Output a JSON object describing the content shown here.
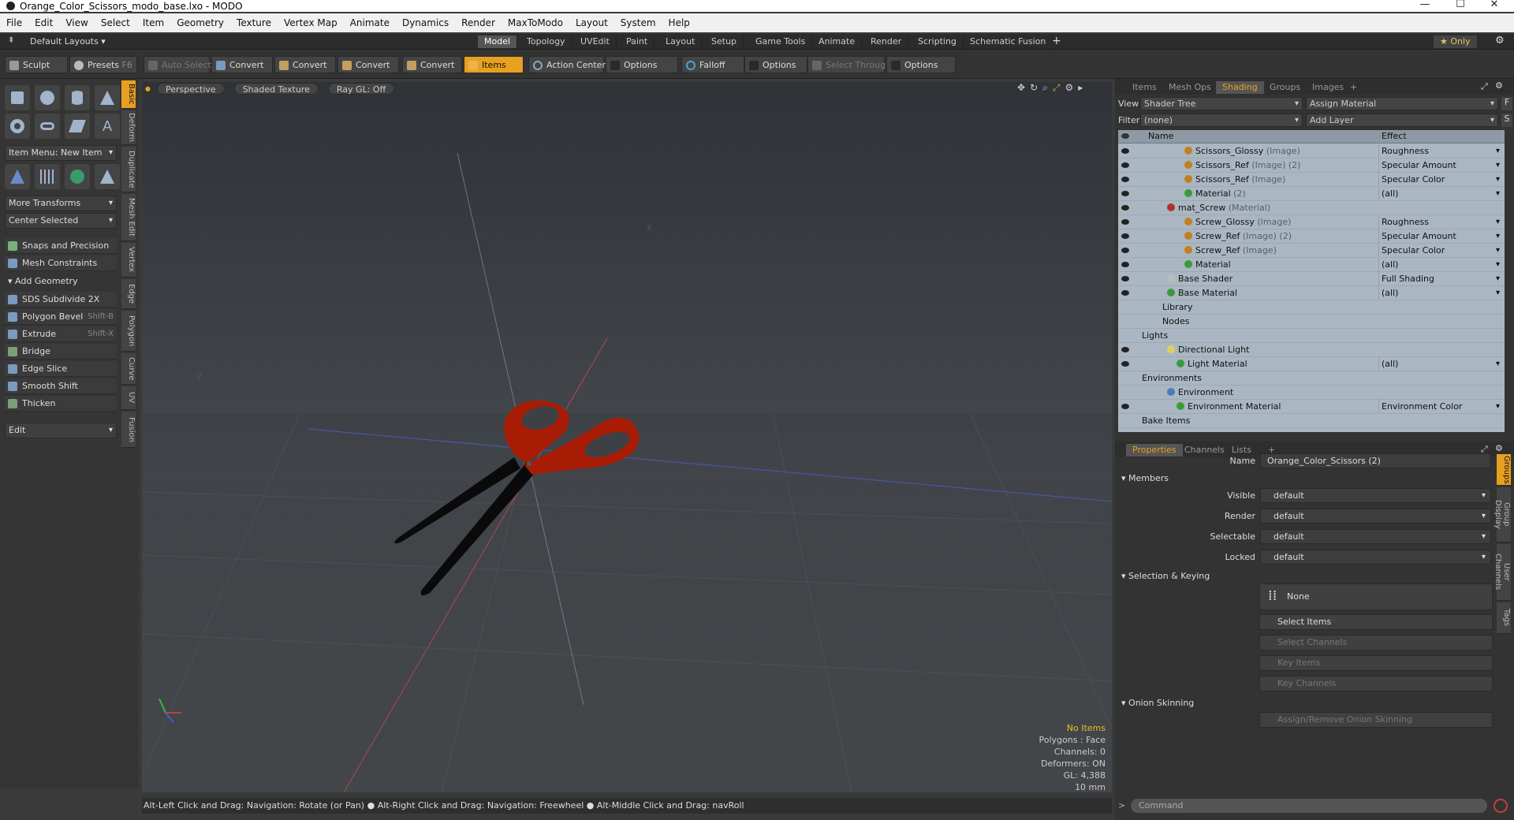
{
  "window": {
    "title": "Orange_Color_Scissors_modo_base.lxo - MODO",
    "min": "—",
    "max": "☐",
    "close": "✕"
  },
  "menu": [
    "File",
    "Edit",
    "View",
    "Select",
    "Item",
    "Geometry",
    "Texture",
    "Vertex Map",
    "Animate",
    "Dynamics",
    "Render",
    "MaxToModo",
    "Layout",
    "System",
    "Help"
  ],
  "layouts": {
    "preset": "Default Layouts ▾",
    "tabs": [
      "Model",
      "Topology",
      "UVEdit",
      "Paint",
      "Layout",
      "Setup",
      "Game Tools",
      "Animate",
      "Render",
      "Scripting",
      "Schematic Fusion"
    ],
    "add": "+",
    "only": "★  Only"
  },
  "toolbar": {
    "sculpt": "Sculpt",
    "presets": "Presets",
    "presets_key": "F6",
    "auto_select": "Auto Select",
    "convert": "Convert",
    "items": "Items",
    "action_center": "Action Center",
    "options": "Options",
    "falloff": "Falloff",
    "select_through": "Select Through"
  },
  "left": {
    "tabs": [
      "Basic",
      "Deform",
      "Duplicate",
      "Mesh Edit",
      "Vertex",
      "Edge",
      "Polygon",
      "Curve",
      "UV",
      "Fusion"
    ],
    "item_menu": "Item Menu: New Item",
    "more_transforms": "More Transforms",
    "center_selected": "Center Selected",
    "snaps": "Snaps and Precision",
    "constraints": "Mesh Constraints",
    "add_geometry": "Add Geometry",
    "tools": [
      {
        "label": "SDS Subdivide 2X",
        "key": ""
      },
      {
        "label": "Polygon Bevel",
        "key": "Shift-B"
      },
      {
        "label": "Extrude",
        "key": "Shift-X"
      },
      {
        "label": "Bridge",
        "key": ""
      },
      {
        "label": "Edge Slice",
        "key": ""
      },
      {
        "label": "Smooth Shift",
        "key": ""
      },
      {
        "label": "Thicken",
        "key": ""
      }
    ],
    "edit": "Edit"
  },
  "viewport": {
    "chips": [
      "Perspective",
      "Shaded Texture",
      "Ray GL: Off"
    ],
    "info": {
      "items": "No Items",
      "polygons": "Polygons : Face",
      "channels": "Channels: 0",
      "deformers": "Deformers: ON",
      "gl": "GL: 4,388",
      "scale": "10 mm"
    },
    "axis_z": "Z",
    "axis_x": "X"
  },
  "status": "Alt-Left Click and Drag: Navigation: Rotate (or Pan) ● Alt-Right Click and Drag: Navigation: Freewheel ● Alt-Middle Click and Drag: navRoll",
  "shading": {
    "tabs": [
      "Items",
      "Mesh Ops",
      "Shading",
      "Groups",
      "Images"
    ],
    "add": "+",
    "view_label": "View",
    "view": "Shader Tree",
    "assign": "Assign Material",
    "filter_label": "Filter",
    "filter": "(none)",
    "add_layer": "Add Layer",
    "col_name": "Name",
    "col_effect": "Effect",
    "rows": [
      {
        "name": "Scissors_Glossy",
        "type": " (Image)",
        "effect": "Roughness",
        "ind": 84,
        "ball": "#c08020",
        "eye": true,
        "dd": true
      },
      {
        "name": "Scissors_Ref",
        "type": " (Image) (2)",
        "effect": "Specular Amount",
        "ind": 84,
        "ball": "#c08020",
        "eye": true,
        "dd": true
      },
      {
        "name": "Scissors_Ref",
        "type": " (Image)",
        "effect": "Specular Color",
        "ind": 84,
        "ball": "#c08020",
        "eye": true,
        "dd": true
      },
      {
        "name": "Material",
        "type": " (2)",
        "effect": "(all)",
        "ind": 84,
        "ball": "#3a9a3a",
        "eye": true,
        "dd": true
      },
      {
        "name": "mat_Screw",
        "type": " (Material)",
        "effect": "",
        "ind": 62,
        "ball": "#b03030",
        "eye": true,
        "dd": false
      },
      {
        "name": "Screw_Glossy",
        "type": " (Image)",
        "effect": "Roughness",
        "ind": 84,
        "ball": "#c08020",
        "eye": true,
        "dd": true
      },
      {
        "name": "Screw_Ref",
        "type": " (Image) (2)",
        "effect": "Specular Amount",
        "ind": 84,
        "ball": "#c08020",
        "eye": true,
        "dd": true
      },
      {
        "name": "Screw_Ref",
        "type": " (Image)",
        "effect": "Specular Color",
        "ind": 84,
        "ball": "#c08020",
        "eye": true,
        "dd": true
      },
      {
        "name": "Material",
        "type": "",
        "effect": "(all)",
        "ind": 84,
        "ball": "#3a9a3a",
        "eye": true,
        "dd": true
      },
      {
        "name": "Base Shader",
        "type": "",
        "effect": "Full Shading",
        "ind": 62,
        "ball": "#bbbbbb",
        "eye": true,
        "dd": true
      },
      {
        "name": "Base Material",
        "type": "",
        "effect": "(all)",
        "ind": 62,
        "ball": "#3a9a3a",
        "eye": true,
        "dd": true
      },
      {
        "name": "Library",
        "type": "",
        "effect": "",
        "ind": 56,
        "ball": "",
        "eye": false,
        "dd": false
      },
      {
        "name": "Nodes",
        "type": "",
        "effect": "",
        "ind": 56,
        "ball": "",
        "eye": false,
        "dd": false
      },
      {
        "name": "Lights",
        "type": "",
        "effect": "",
        "ind": 30,
        "ball": "",
        "eye": false,
        "dd": false
      },
      {
        "name": "Directional Light",
        "type": "",
        "effect": "",
        "ind": 62,
        "ball": "#ddd060",
        "eye": true,
        "dd": false
      },
      {
        "name": "Light Material",
        "type": "",
        "effect": "(all)",
        "ind": 74,
        "ball": "#3a9a3a",
        "eye": true,
        "dd": true
      },
      {
        "name": "Environments",
        "type": "",
        "effect": "",
        "ind": 30,
        "ball": "",
        "eye": false,
        "dd": false
      },
      {
        "name": "Environment",
        "type": "",
        "effect": "",
        "ind": 62,
        "ball": "#4a7ac0",
        "eye": false,
        "dd": false
      },
      {
        "name": "Environment Material",
        "type": "",
        "effect": "Environment Color",
        "ind": 74,
        "ball": "#3a9a3a",
        "eye": true,
        "dd": true
      },
      {
        "name": "Bake Items",
        "type": "",
        "effect": "",
        "ind": 30,
        "ball": "",
        "eye": false,
        "dd": false
      }
    ]
  },
  "props": {
    "tabs": [
      "Properties",
      "Channels",
      "Lists"
    ],
    "add": "+",
    "name_label": "Name",
    "name_value": "Orange_Color_Scissors (2)",
    "members": "Members",
    "fields": [
      {
        "label": "Visible",
        "value": "default"
      },
      {
        "label": "Render",
        "value": "default"
      },
      {
        "label": "Selectable",
        "value": "default"
      },
      {
        "label": "Locked",
        "value": "default"
      }
    ],
    "sel_keying": "Selection & Keying",
    "none": "None",
    "select_items": "Select Items",
    "select_channels": "Select Channels",
    "key_items": "Key Items",
    "key_channels": "Key Channels",
    "onion": "Onion Skinning",
    "assign_onion": "Assign/Remove Onion Skinning",
    "side_tabs": [
      "Groups",
      "Group Display",
      "User Channels",
      "Tags"
    ]
  },
  "command": {
    "placeholder": "Command"
  },
  "colors": {
    "accent": "#e8a020",
    "scissor_handle": "#a81c05",
    "blade": "#0a0a0a"
  }
}
